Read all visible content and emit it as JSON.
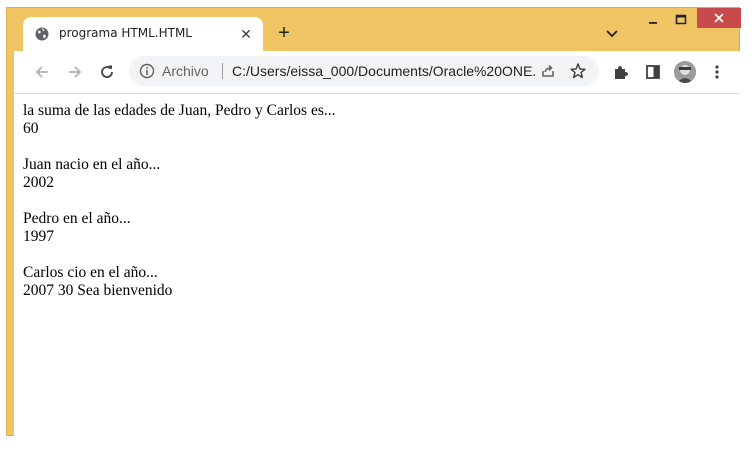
{
  "browser": {
    "tab": {
      "title": "programa HTML.HTML",
      "close_glyph": "✕",
      "favicon": "globe-icon"
    },
    "new_tab_glyph": "+",
    "omnibox": {
      "label": "Archivo",
      "url": "C:/Users/eissa_000/Documents/Oracle%20ONE..."
    },
    "colors": {
      "frame": "#f1c463",
      "close_button": "#c94a4a"
    }
  },
  "page": {
    "line1": "la suma de las edades de Juan, Pedro y Carlos es...",
    "line2": "60",
    "line3": "Juan nacio en el año...",
    "line4": "2002",
    "line5": "Pedro en el año...",
    "line6": "1997",
    "line7": "Carlos cio en el año...",
    "line8": "2007 30 Sea bienvenido"
  }
}
